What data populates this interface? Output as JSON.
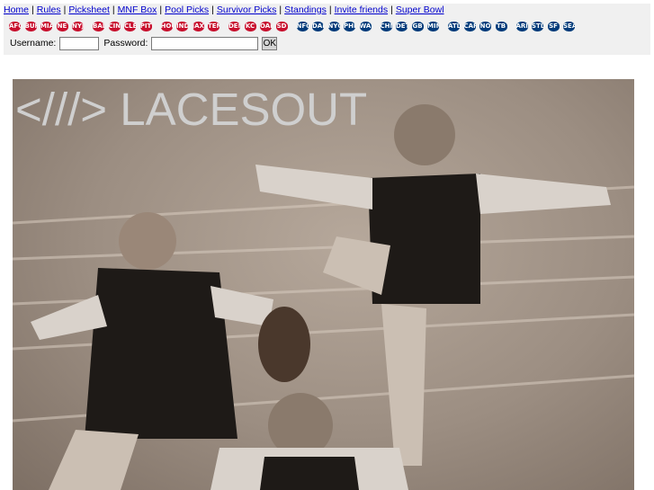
{
  "nav": {
    "links": [
      "Home",
      "Rules",
      "Picksheet",
      "MNF Box",
      "Pool Picks",
      "Survivor Picks",
      "Standings",
      "Invite friends",
      "Super Bowl"
    ]
  },
  "teams": {
    "afc": [
      "AFC",
      "BUF",
      "MIA",
      "NE",
      "NYJ",
      "BAL",
      "CIN",
      "CLE",
      "PIT",
      "HOU",
      "IND",
      "JAX",
      "TEN",
      "DEN",
      "KC",
      "OAK",
      "SD"
    ],
    "nfc": [
      "NFC",
      "DAL",
      "NYG",
      "PHI",
      "WAS",
      "CHI",
      "DET",
      "GB",
      "MIN",
      "ATL",
      "CAR",
      "NO",
      "TB",
      "ARI",
      "STL",
      "SF",
      "SEA"
    ]
  },
  "login": {
    "username_label": "Username:",
    "password_label": "Password:",
    "username_value": "",
    "password_value": "",
    "submit_label": "OK"
  },
  "hero": {
    "brand": "<///> LACESOUT"
  }
}
